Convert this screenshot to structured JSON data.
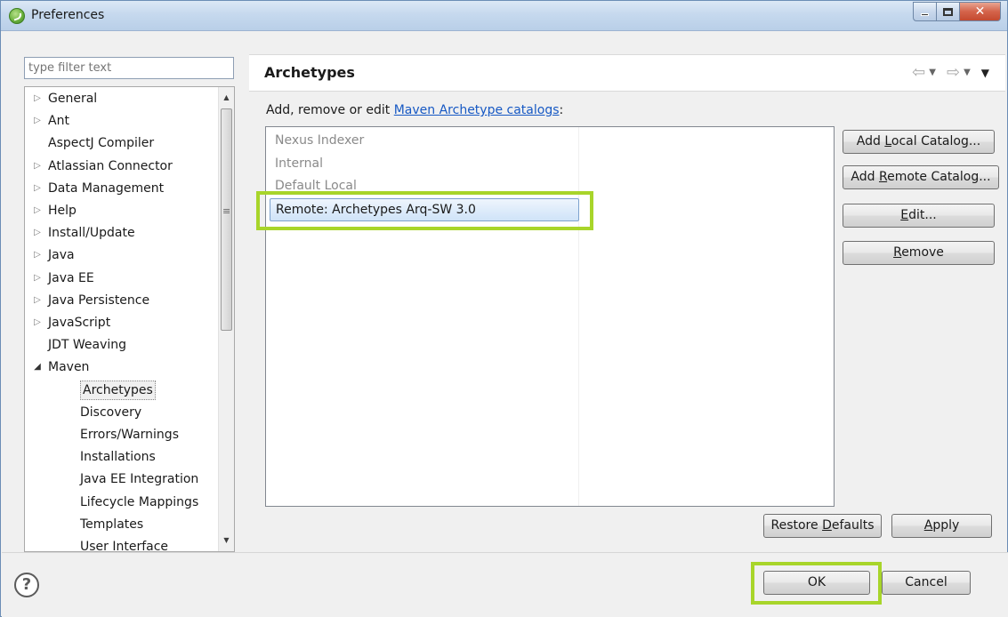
{
  "window": {
    "title": "Preferences",
    "icon": "spring-leaf-icon"
  },
  "filter": {
    "placeholder": "type filter text"
  },
  "tree": {
    "items": [
      {
        "label": "General",
        "expandable": true,
        "level": 0
      },
      {
        "label": "Ant",
        "expandable": true,
        "level": 0
      },
      {
        "label": "AspectJ Compiler",
        "expandable": false,
        "level": 0
      },
      {
        "label": "Atlassian Connector",
        "expandable": true,
        "level": 0
      },
      {
        "label": "Data Management",
        "expandable": true,
        "level": 0
      },
      {
        "label": "Help",
        "expandable": true,
        "level": 0
      },
      {
        "label": "Install/Update",
        "expandable": true,
        "level": 0
      },
      {
        "label": "Java",
        "expandable": true,
        "level": 0
      },
      {
        "label": "Java EE",
        "expandable": true,
        "level": 0
      },
      {
        "label": "Java Persistence",
        "expandable": true,
        "level": 0
      },
      {
        "label": "JavaScript",
        "expandable": true,
        "level": 0
      },
      {
        "label": "JDT Weaving",
        "expandable": false,
        "level": 0
      },
      {
        "label": "Maven",
        "expanded": true,
        "level": 0
      },
      {
        "label": "Archetypes",
        "level": 1,
        "selected": true
      },
      {
        "label": "Discovery",
        "level": 1
      },
      {
        "label": "Errors/Warnings",
        "level": 1
      },
      {
        "label": "Installations",
        "level": 1
      },
      {
        "label": "Java EE Integration",
        "level": 1
      },
      {
        "label": "Lifecycle Mappings",
        "level": 1
      },
      {
        "label": "Templates",
        "level": 1
      },
      {
        "label": "User Interface",
        "level": 1
      }
    ]
  },
  "page": {
    "title": "Archetypes",
    "description_prefix": "Add, remove or edit ",
    "description_link": "Maven Archetype catalogs",
    "description_suffix": ":"
  },
  "catalogs": [
    {
      "label": "Nexus Indexer",
      "selected": false
    },
    {
      "label": "Internal",
      "selected": false
    },
    {
      "label": "Default Local",
      "selected": false
    },
    {
      "label": "Remote: Archetypes Arq-SW 3.0",
      "selected": true
    }
  ],
  "buttons": {
    "add_local": {
      "pre": "Add ",
      "key": "L",
      "post": "ocal Catalog..."
    },
    "add_remote": {
      "pre": "Add ",
      "key": "R",
      "post": "emote Catalog..."
    },
    "edit": {
      "pre": "",
      "key": "E",
      "post": "dit..."
    },
    "remove": {
      "pre": "",
      "key": "R",
      "post": "emove"
    },
    "restore_defaults": {
      "pre": "Restore ",
      "key": "D",
      "post": "efaults"
    },
    "apply": {
      "pre": "",
      "key": "A",
      "post": "pply"
    },
    "ok": "OK",
    "cancel": "Cancel"
  },
  "accent": {
    "highlight": "#a8d52a",
    "link": "#1759c4",
    "selection": "#cfe3f8"
  }
}
